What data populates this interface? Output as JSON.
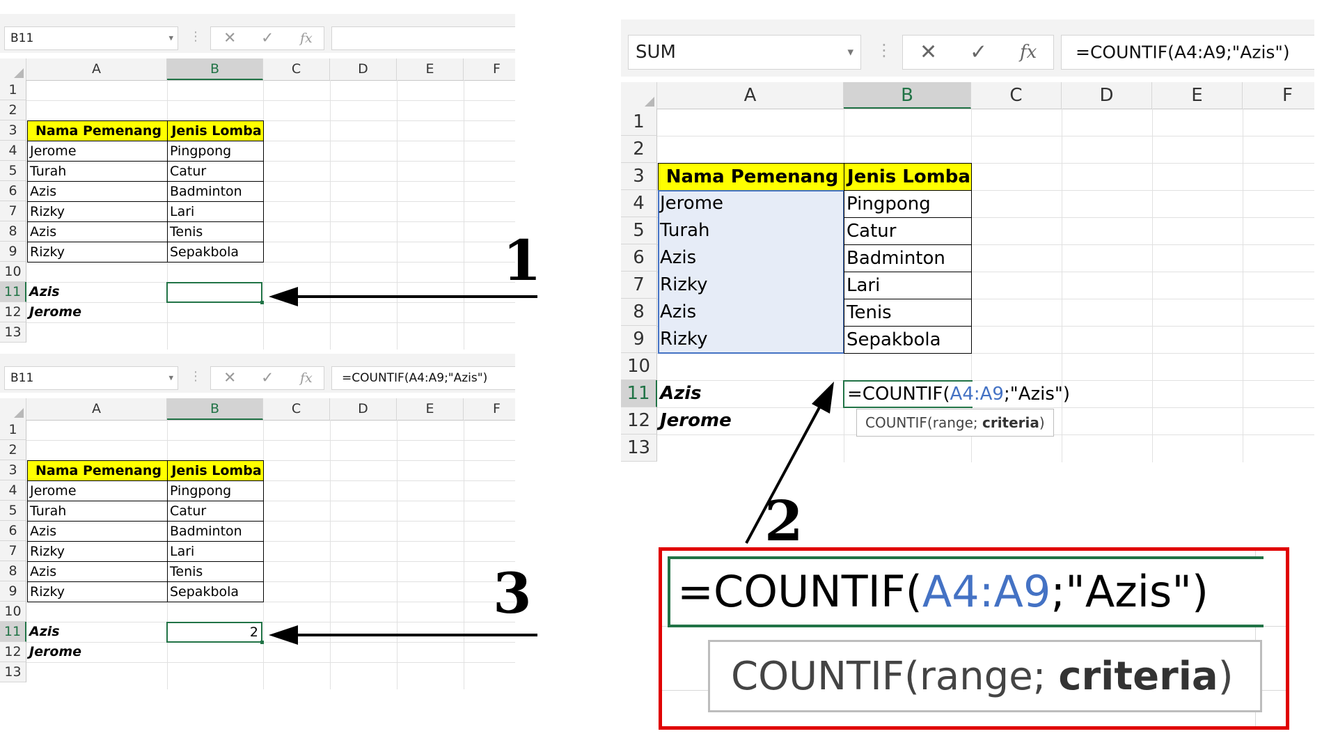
{
  "panel1": {
    "name_box": "B11",
    "formula": "",
    "columns": [
      "A",
      "B",
      "C",
      "D",
      "E",
      "F"
    ],
    "rows": [
      "1",
      "2",
      "3",
      "4",
      "5",
      "6",
      "7",
      "8",
      "9",
      "10",
      "11",
      "12",
      "13"
    ],
    "headers": [
      "Nama Pemenang",
      "Jenis Lomba"
    ],
    "names": [
      "Jerome",
      "Turah",
      "Azis",
      "Rizky",
      "Azis",
      "Rizky"
    ],
    "sports": [
      "Pingpong",
      "Catur",
      "Badminton",
      "Lari",
      "Tenis",
      "Sepakbola"
    ],
    "criteria": [
      "Azis",
      "Jerome"
    ],
    "b11": "",
    "step": "1"
  },
  "panel3": {
    "name_box": "B11",
    "formula": "=COUNTIF(A4:A9;\"Azis\")",
    "columns": [
      "A",
      "B",
      "C",
      "D",
      "E",
      "F"
    ],
    "rows": [
      "1",
      "2",
      "3",
      "4",
      "5",
      "6",
      "7",
      "8",
      "9",
      "10",
      "11",
      "12",
      "13"
    ],
    "headers": [
      "Nama Pemenang",
      "Jenis Lomba"
    ],
    "names": [
      "Jerome",
      "Turah",
      "Azis",
      "Rizky",
      "Azis",
      "Rizky"
    ],
    "sports": [
      "Pingpong",
      "Catur",
      "Badminton",
      "Lari",
      "Tenis",
      "Sepakbola"
    ],
    "criteria": [
      "Azis",
      "Jerome"
    ],
    "b11": "2",
    "step": "3"
  },
  "panel2": {
    "name_box": "SUM",
    "formula": "=COUNTIF(A4:A9;\"Azis\")",
    "columns": [
      "A",
      "B",
      "C",
      "D",
      "E",
      "F"
    ],
    "rows": [
      "1",
      "2",
      "3",
      "4",
      "5",
      "6",
      "7",
      "8",
      "9",
      "10",
      "11",
      "12",
      "13"
    ],
    "headers": [
      "Nama Pemenang",
      "Jenis Lomba"
    ],
    "names": [
      "Jerome",
      "Turah",
      "Azis",
      "Rizky",
      "Azis",
      "Rizky"
    ],
    "sports": [
      "Pingpong",
      "Catur",
      "Badminton",
      "Lari",
      "Tenis",
      "Sepakbola"
    ],
    "criteria": [
      "Azis",
      "Jerome"
    ],
    "edit": {
      "pre": "=COUNTIF(",
      "ref": "A4:A9",
      "post": ";\"Azis\")"
    },
    "tooltip": {
      "pre": "COUNTIF(range; ",
      "bold": "criteria",
      "post": ")"
    },
    "step": "2"
  },
  "zoom": {
    "edit": {
      "pre": "=COUNTIF(",
      "ref": "A4:A9",
      "post": ";\"Azis\")"
    },
    "tooltip": {
      "pre": "COUNTIF(range; ",
      "bold": "criteria",
      "post": ")"
    }
  },
  "icons": {
    "cancel": "✕",
    "enter": "✓",
    "fx": "fx",
    "dropdown": "▾",
    "separator": "⋮"
  },
  "colors": {
    "excel_green": "#217346",
    "header_fill": "#ffff00",
    "range_blue": "#4472c4",
    "zoom_border": "#e00000"
  }
}
